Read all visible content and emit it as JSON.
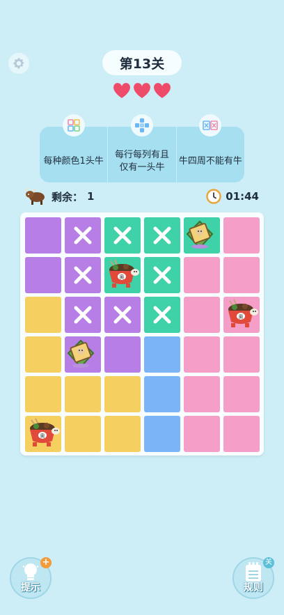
{
  "header": {
    "level_title": "第13关",
    "hearts": 3
  },
  "rules": [
    {
      "text": "每种颜色1头牛",
      "icon": "color-grid-icon"
    },
    {
      "text": "每行每列有且仅有一头牛",
      "icon": "cross-grid-icon"
    },
    {
      "text": "牛四周不能有牛",
      "icon": "no-adjacent-icon"
    }
  ],
  "status": {
    "remaining_label": "剩余：",
    "remaining_count": "1",
    "timer": "01:44"
  },
  "colors": {
    "purple": "#b77fe6",
    "green": "#3fd1a7",
    "pink": "#f49ec8",
    "yellow": "#f5d060",
    "blue": "#7cb5f7"
  },
  "board": {
    "rows": 6,
    "cols": 6,
    "colors": [
      [
        "purple",
        "purple",
        "green",
        "green",
        "green",
        "pink"
      ],
      [
        "purple",
        "purple",
        "green",
        "green",
        "pink",
        "pink"
      ],
      [
        "yellow",
        "purple",
        "purple",
        "green",
        "pink",
        "pink"
      ],
      [
        "yellow",
        "purple",
        "purple",
        "blue",
        "pink",
        "pink"
      ],
      [
        "yellow",
        "yellow",
        "yellow",
        "blue",
        "pink",
        "pink"
      ],
      [
        "yellow",
        "yellow",
        "yellow",
        "blue",
        "pink",
        "pink"
      ]
    ],
    "marks": [
      [
        0,
        1
      ],
      [
        0,
        2
      ],
      [
        0,
        3
      ],
      [
        1,
        1
      ],
      [
        1,
        3
      ],
      [
        2,
        1
      ],
      [
        2,
        2
      ],
      [
        2,
        3
      ]
    ],
    "cows": [
      {
        "r": 0,
        "c": 4,
        "kind": "zongzi"
      },
      {
        "r": 1,
        "c": 2,
        "kind": "bowl"
      },
      {
        "r": 2,
        "c": 5,
        "kind": "bowl"
      },
      {
        "r": 3,
        "c": 1,
        "kind": "zongzi"
      },
      {
        "r": 5,
        "c": 0,
        "kind": "bowl"
      }
    ]
  },
  "buttons": {
    "hint_label": "提示",
    "hint_badge": "+",
    "rules_label": "规则",
    "rules_badge": "关"
  }
}
